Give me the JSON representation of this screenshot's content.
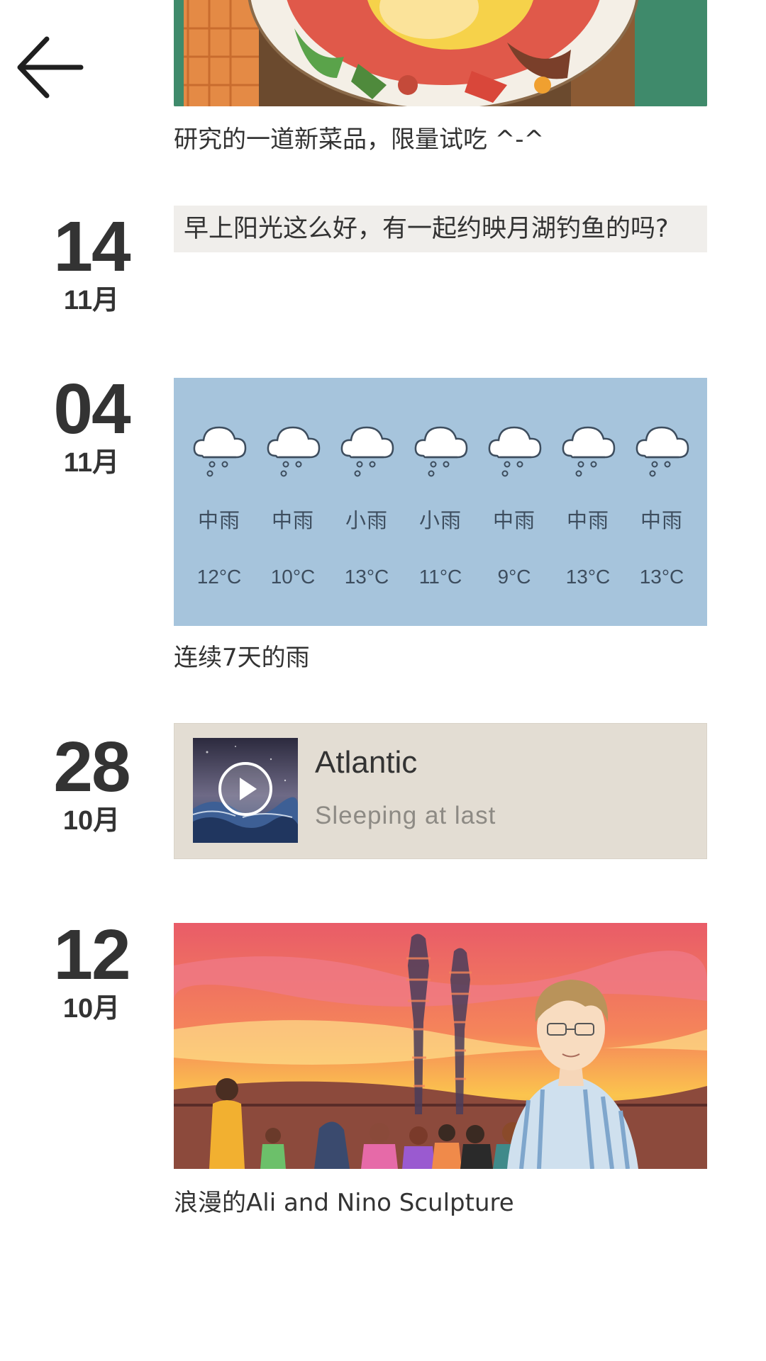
{
  "header": {
    "back_icon": "arrow-left-icon"
  },
  "entries": [
    {
      "caption": "研究的一道新菜品，限量试吃 ^-^",
      "image": "food-illustration"
    },
    {
      "day": "14",
      "month": "11月",
      "text": "早上阳光这么好，有一起约映月湖钓鱼的吗?"
    },
    {
      "day": "04",
      "month": "11月",
      "weather": [
        {
          "condition": "中雨",
          "temp": "12°C"
        },
        {
          "condition": "中雨",
          "temp": "10°C"
        },
        {
          "condition": "小雨",
          "temp": "13°C"
        },
        {
          "condition": "小雨",
          "temp": "11°C"
        },
        {
          "condition": "中雨",
          "temp": "9°C"
        },
        {
          "condition": "中雨",
          "temp": "13°C"
        },
        {
          "condition": "中雨",
          "temp": "13°C"
        }
      ],
      "caption": "连续7天的雨"
    },
    {
      "day": "28",
      "month": "10月",
      "song": {
        "title": "Atlantic",
        "artist": "Sleeping at last"
      }
    },
    {
      "day": "12",
      "month": "10月",
      "image": "sunset-sculpture-illustration",
      "caption": "浪漫的Ali and Nino Sculpture"
    }
  ],
  "colors": {
    "text": "#333333",
    "text_card_bg": "#f0eeeb",
    "weather_bg": "#a6c4dc",
    "music_bg": "#e3ddd3"
  }
}
